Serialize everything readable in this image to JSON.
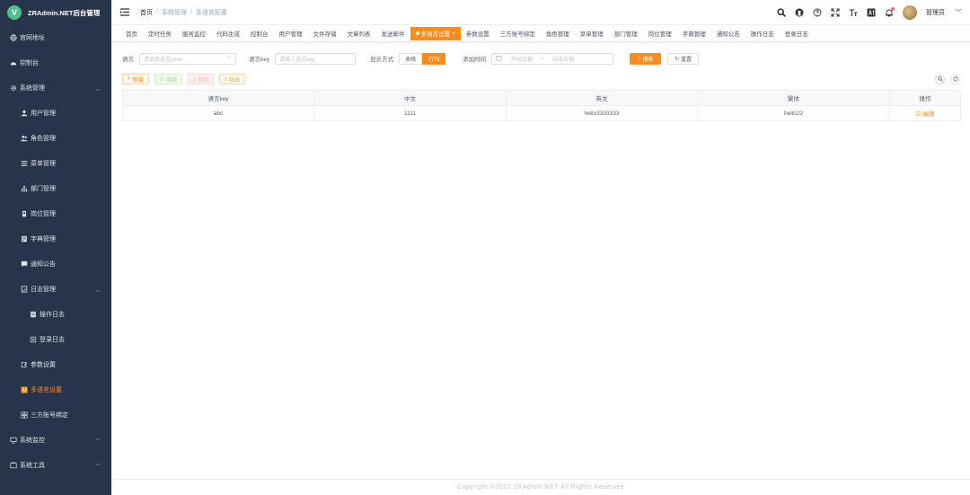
{
  "app": {
    "logo_letter": "V",
    "title": "ZRAdmin.NET后台管理"
  },
  "sidebar": {
    "items": [
      {
        "label": "官网地址",
        "icon": "globe-icon"
      },
      {
        "label": "控制台",
        "icon": "dashboard-icon"
      },
      {
        "label": "系统管理",
        "icon": "gear-icon"
      },
      {
        "label": "用户管理",
        "icon": "user-icon"
      },
      {
        "label": "角色管理",
        "icon": "users-icon"
      },
      {
        "label": "菜单管理",
        "icon": "menu-list-icon"
      },
      {
        "label": "部门管理",
        "icon": "tree-icon"
      },
      {
        "label": "岗位管理",
        "icon": "post-icon"
      },
      {
        "label": "字典管理",
        "icon": "dict-icon"
      },
      {
        "label": "通知公告",
        "icon": "message-icon"
      },
      {
        "label": "日志管理",
        "icon": "log-icon"
      },
      {
        "label": "操作日志",
        "icon": "form-icon"
      },
      {
        "label": "登录日志",
        "icon": "login-log-icon"
      },
      {
        "label": "参数设置",
        "icon": "edit-icon"
      },
      {
        "label": "多语言设置",
        "icon": "language-icon"
      },
      {
        "label": "三方账号绑定",
        "icon": "link-icon"
      },
      {
        "label": "系统监控",
        "icon": "monitor-icon"
      },
      {
        "label": "系统工具",
        "icon": "tool-icon"
      }
    ]
  },
  "breadcrumb": {
    "home": "首页",
    "mid": "系统管理",
    "current": "多语言配置",
    "sep": "/"
  },
  "navbar": {
    "user_name": "管理员",
    "colors": {
      "accent": "#ff8c1a"
    }
  },
  "tags": [
    "首页",
    "定时任务",
    "服务监控",
    "代码生成",
    "控制台",
    "用户管理",
    "文件存储",
    "文章列表",
    "发送邮件",
    "多语言设置",
    "参数设置",
    "三方账号绑定",
    "角色管理",
    "菜单管理",
    "部门管理",
    "岗位管理",
    "字典管理",
    "通知公告",
    "操作日志",
    "登录日志"
  ],
  "search": {
    "lang_label": "语言",
    "lang_placeholder": "请选择语言code",
    "key_label": "语言key",
    "key_placeholder": "请输入语言key",
    "display_label": "显示方式",
    "display_table": "表格",
    "display_row": "行列",
    "time_label": "添加时间",
    "start_placeholder": "开始日期",
    "range_sep": "-",
    "end_placeholder": "结束日期",
    "search_btn": "搜索",
    "reset_btn": "重置"
  },
  "toolbar": {
    "add": "新增",
    "edit": "编辑",
    "delete": "删除",
    "export": "导出"
  },
  "table": {
    "headers": [
      "语言key",
      "中文",
      "英文",
      "繁体",
      "操作"
    ],
    "rows": [
      {
        "key": "abc",
        "zh": "1111",
        "en": "hello3333333",
        "tw": "hello22",
        "action": "编辑"
      }
    ]
  },
  "footer": "Copyright ©2022 ZRAdmin.NET All Rights Reserved"
}
